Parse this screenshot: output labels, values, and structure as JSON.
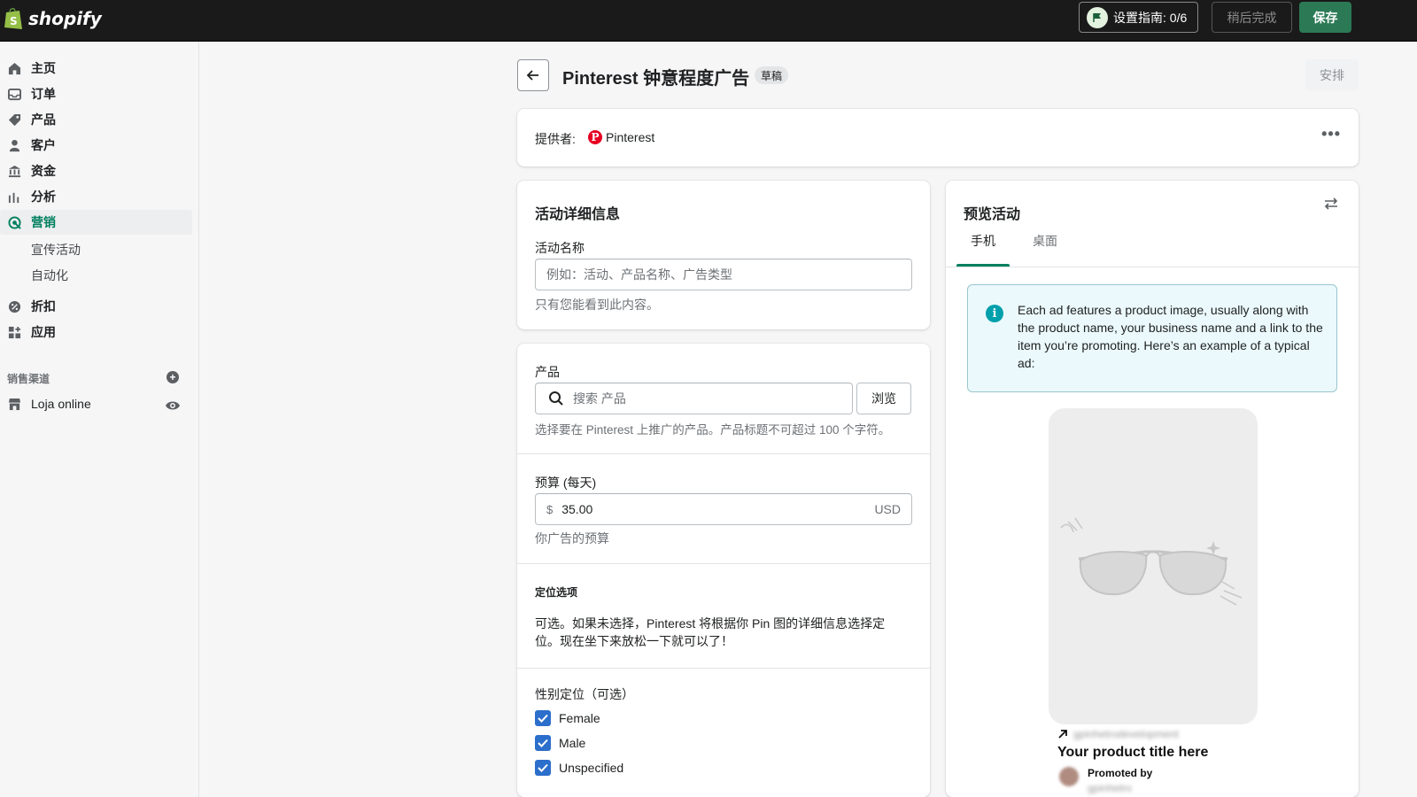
{
  "topbar": {
    "brand": "shopify",
    "setup_guide": "设置指南: 0/6",
    "later": "稍后完成",
    "save": "保存"
  },
  "sidebar": {
    "items": [
      {
        "label": "主页",
        "icon": "home-icon"
      },
      {
        "label": "订单",
        "icon": "orders-icon"
      },
      {
        "label": "产品",
        "icon": "tag-icon"
      },
      {
        "label": "客户",
        "icon": "person-icon"
      },
      {
        "label": "资金",
        "icon": "bank-icon"
      },
      {
        "label": "分析",
        "icon": "bar-chart-icon"
      },
      {
        "label": "营销",
        "icon": "target-icon",
        "active": true
      }
    ],
    "sub_items": [
      "宣传活动",
      "自动化"
    ],
    "items2": [
      {
        "label": "折扣",
        "icon": "discount-icon"
      },
      {
        "label": "应用",
        "icon": "apps-icon"
      }
    ],
    "channels_label": "销售渠道",
    "channel": "Loja online"
  },
  "page": {
    "title": "Pinterest 钟意程度广告",
    "badge": "草稿",
    "schedule": "安排"
  },
  "provider": {
    "label": "提供者:",
    "name": "Pinterest"
  },
  "details": {
    "title": "活动详细信息",
    "name_label": "活动名称",
    "name_placeholder": "例如：活动、产品名称、广告类型",
    "name_help": "只有您能看到此内容。"
  },
  "form": {
    "product_label": "产品",
    "product_placeholder": "搜索 产品",
    "browse": "浏览",
    "product_help": "选择要在 Pinterest 上推广的产品。产品标题不可超过 100 个字符。",
    "budget_label": "预算 (每天)",
    "budget_prefix": "$",
    "budget_value": "35.00",
    "budget_currency": "USD",
    "budget_help": "你广告的预算",
    "targeting_head": "定位选项",
    "targeting_text": "可选。如果未选择，Pinterest 将根据你 Pin 图的详细信息选择定位。现在坐下来放松一下就可以了！",
    "gender_label": "性别定位（可选）",
    "genders": [
      {
        "label": "Female",
        "checked": true
      },
      {
        "label": "Male",
        "checked": true
      },
      {
        "label": "Unspecified",
        "checked": true
      }
    ]
  },
  "preview": {
    "title": "预览活动",
    "tabs": [
      "手机",
      "桌面"
    ],
    "active_tab": 0,
    "info": "Each ad features a product image, usually along with the product name, your business name and a link to the item you’re promoting. Here’s an example of a typical ad:",
    "link": "gpinhetrodevelopment",
    "ad_title": "Your product title here",
    "promoted_by": "Promoted by",
    "promoter": "gpinhetro"
  },
  "colors": {
    "topbar": "#1a1a1a",
    "primary": "#2b7a55",
    "active_nav": "#007f5f",
    "checkbox": "#2c6ecb",
    "info_bg": "#ebf9fc",
    "pinterest": "#e60023"
  }
}
